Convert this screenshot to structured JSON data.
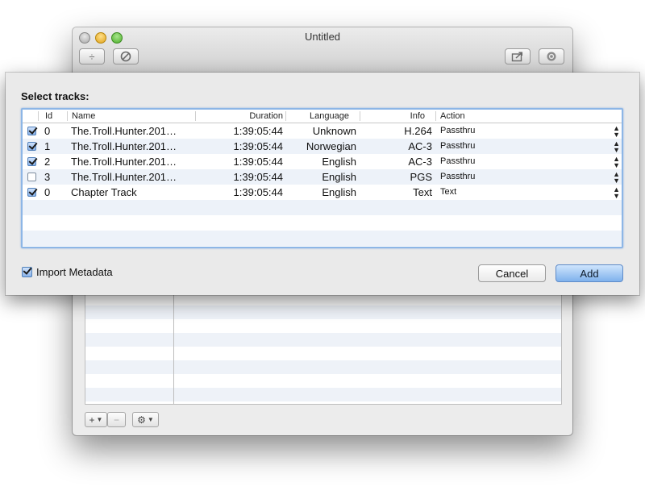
{
  "window": {
    "title": "Untitled",
    "toolbar": {
      "add_icon": "plus-minus-icon",
      "stop_icon": "stop-icon",
      "share_icon": "share-icon",
      "search_icon": "search-icon"
    }
  },
  "sheet": {
    "title": "Select tracks:",
    "columns": [
      "Id",
      "Name",
      "Duration",
      "Language",
      "Info",
      "Action"
    ],
    "rows": [
      {
        "checked": true,
        "id": "0",
        "name": "The.Troll.Hunter.201…",
        "duration": "1:39:05:44",
        "language": "Unknown",
        "info": "H.264",
        "action": "Passthru"
      },
      {
        "checked": true,
        "id": "1",
        "name": "The.Troll.Hunter.201…",
        "duration": "1:39:05:44",
        "language": "Norwegian",
        "info": "AC-3",
        "action": "Passthru"
      },
      {
        "checked": true,
        "id": "2",
        "name": "The.Troll.Hunter.201…",
        "duration": "1:39:05:44",
        "language": "English",
        "info": "AC-3",
        "action": "Passthru"
      },
      {
        "checked": false,
        "id": "3",
        "name": "The.Troll.Hunter.201…",
        "duration": "1:39:05:44",
        "language": "English",
        "info": "PGS",
        "action": "Passthru"
      },
      {
        "checked": true,
        "id": "0",
        "name": "Chapter Track",
        "duration": "1:39:05:44",
        "language": "English",
        "info": "Text",
        "action": "Text"
      }
    ],
    "import_metadata": {
      "label": "Import Metadata",
      "checked": true
    },
    "cancel_label": "Cancel",
    "add_label": "Add"
  },
  "colors": {
    "selection_border": "#8db6e6",
    "default_button": "#7fb1ec",
    "stripe": "#edf2f9"
  }
}
